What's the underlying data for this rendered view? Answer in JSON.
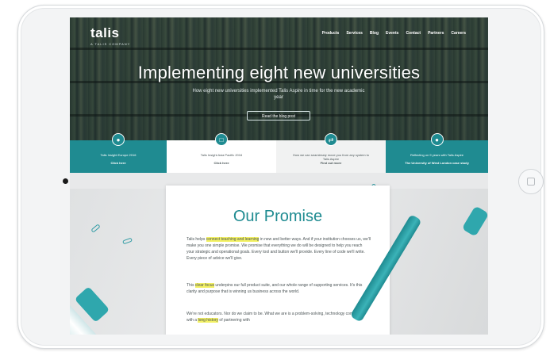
{
  "site": {
    "logo": "talis",
    "logo_sub": "A TALIS COMPANY"
  },
  "nav": {
    "items": [
      "Products",
      "Services",
      "Blog",
      "Events",
      "Contact",
      "Partners",
      "Careers"
    ]
  },
  "hero": {
    "title": "Implementing eight new universities",
    "subtitle": "How eight new universities implemented Talis Aspire in time for the new academic year",
    "button": "Read the blog post"
  },
  "tiles": [
    {
      "text": "Talis Insight Europe 2016",
      "link": "Click here",
      "icon": "lightbulb-icon"
    },
    {
      "text": "Talis Insight Asia Pacific 2016",
      "link": "Click here",
      "icon": "monitor-icon"
    },
    {
      "text": "How we can seamlessly move you from any system to Talis Aspire",
      "link": "Find out more",
      "icon": "arrows-icon"
    },
    {
      "text": "Reflecting on 9 years with Talis Aspire",
      "link": "The University of West London case study",
      "icon": "lightbulb-icon"
    }
  ],
  "promise": {
    "title": "Our Promise",
    "p1_pre": "Talis helps ",
    "p1_hl": "connect teaching and learning",
    "p1_post": " in new and better ways. And if your institution chooses us, we'll make you one simple promise. We promise that everything we do will be designed to help you reach your strategic and operational goals. Every tool and button we'll provide. Every line of code we'll write. Every piece of advice we'll give.",
    "p2_pre": "This ",
    "p2_hl": "clear focus",
    "p2_post": " underpins our full product suite, and our whole range of supporting services. It's this clarity and purpose that is winning us business across the world.",
    "p3_pre": "We're not educators. Nor do we claim to be. What we are is a problem-solving, technology company, with a ",
    "p3_hl": "long history",
    "p3_post": " of partnering with"
  },
  "colors": {
    "teal": "#1f8b91",
    "highlight": "#f3f164"
  }
}
